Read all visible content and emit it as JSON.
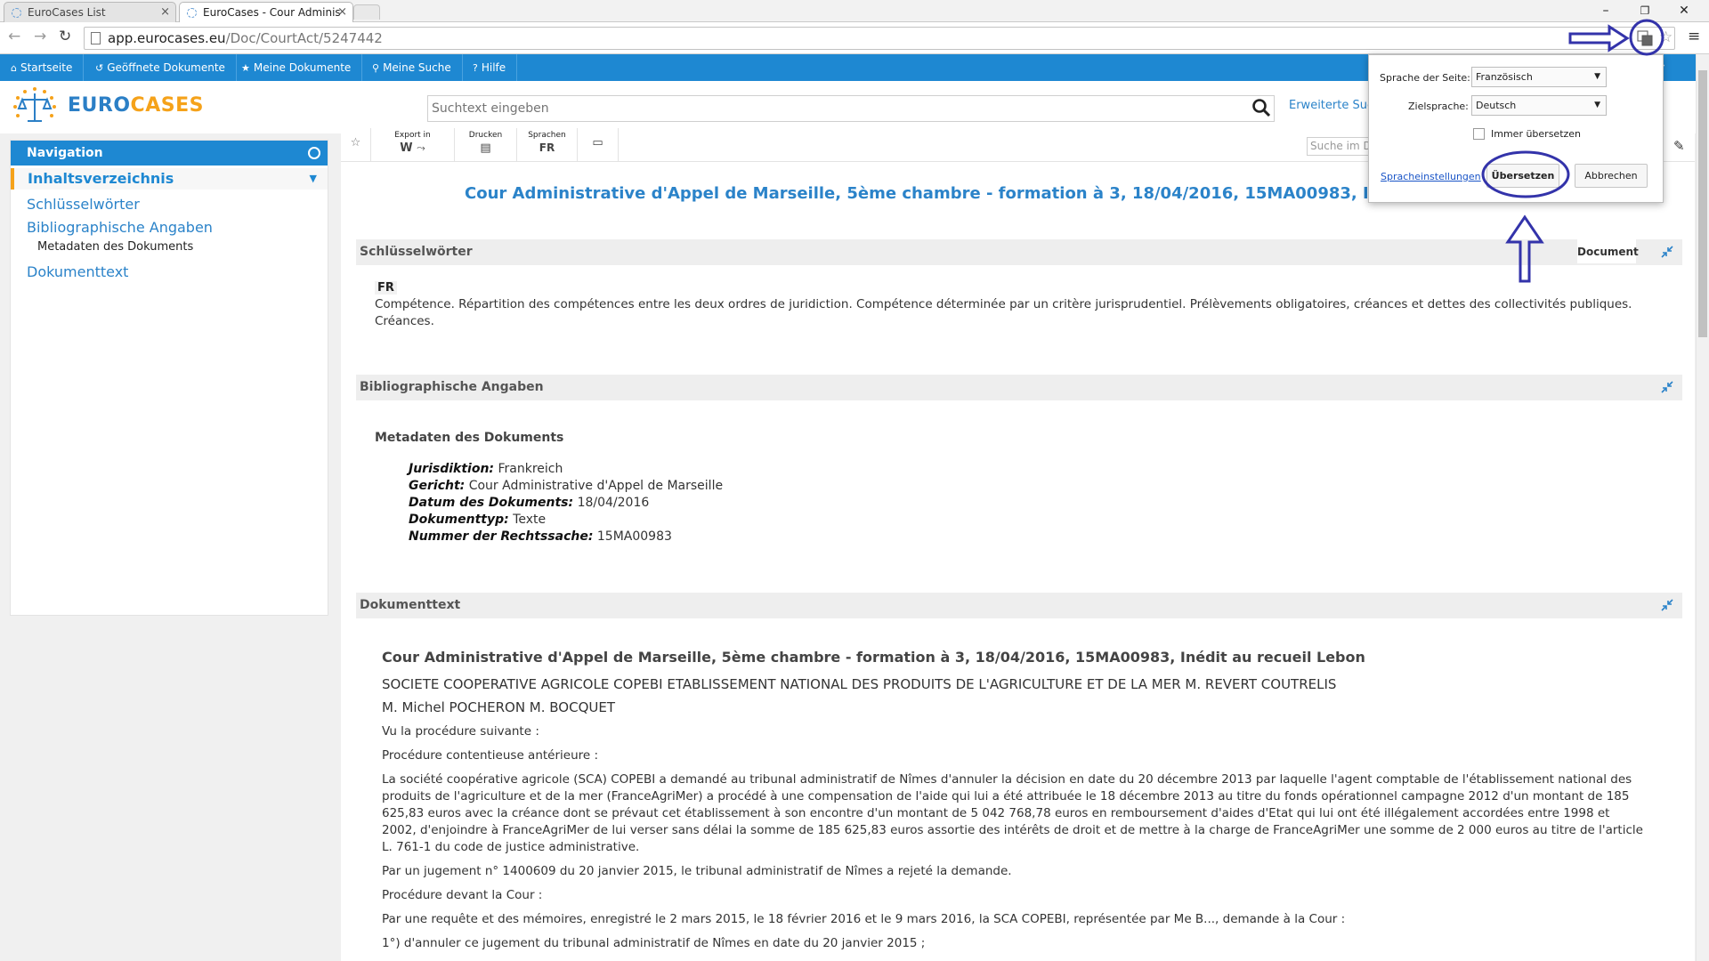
{
  "browser": {
    "tabs": [
      {
        "title": "EuroCases List"
      },
      {
        "title": "EuroCases - Cour Adminis"
      }
    ],
    "url_host": "app.eurocases.eu",
    "url_path": "/Doc/CourtAct/5247442"
  },
  "appnav": {
    "items": [
      {
        "label": "Startseite"
      },
      {
        "label": "Geöffnete Dokumente"
      },
      {
        "label": "Meine Dokumente"
      },
      {
        "label": "Meine Suche"
      },
      {
        "label": "Hilfe"
      }
    ]
  },
  "brand": {
    "part1": "EURO",
    "part2": "CASES"
  },
  "search": {
    "placeholder": "Suchtext eingeben",
    "advanced": "Erweiterte Suche"
  },
  "sidebar": {
    "header": "Navigation",
    "toc": "Inhaltsverzeichnis",
    "items": [
      {
        "label": "Schlüsselwörter"
      },
      {
        "label": "Bibliographische Angaben"
      },
      {
        "label": "Metadaten des Dokuments"
      },
      {
        "label": "Dokumenttext"
      }
    ]
  },
  "toolbar": {
    "export_label": "Export in",
    "print_label": "Drucken",
    "lang_label": "Sprachen",
    "lang_value": "FR",
    "find_placeholder": "Suche im Dokument"
  },
  "document": {
    "title": "Cour Administrative d'Appel de Marseille, 5ème chambre - formation à 3, 18/04/2016, 15MA00983, Inédit au recueil Lebon",
    "keywords_section": "Schlüsselwörter",
    "keywords_tab": "Document",
    "keywords_lang": "FR",
    "keywords_text": "Compétence. Répartition des compétences entre les deux ordres de juridiction. Compétence déterminée par un critère jurisprudentiel. Prélèvements obligatoires, créances et dettes des collectivités publiques. Créances.",
    "biblio_section": "Bibliographische Angaben",
    "meta_heading": "Metadaten des Dokuments",
    "meta": [
      {
        "key": "Jurisdiktion:",
        "value": "Frankreich"
      },
      {
        "key": "Gericht:",
        "value": "Cour Administrative d'Appel de Marseille"
      },
      {
        "key": "Datum des Dokuments:",
        "value": "18/04/2016"
      },
      {
        "key": "Dokumenttyp:",
        "value": "Texte"
      },
      {
        "key": "Nummer der Rechtssache:",
        "value": "15MA00983"
      }
    ],
    "text_section": "Dokumenttext",
    "text_title": "Cour Administrative d'Appel de Marseille, 5ème chambre - formation à 3, 18/04/2016, 15MA00983, Inédit au recueil Lebon",
    "parties": "SOCIETE COOPERATIVE AGRICOLE COPEBI ETABLISSEMENT NATIONAL DES PRODUITS DE L'AGRICULTURE ET DE LA MER M. REVERT COUTRELIS",
    "judges": "M. Michel POCHERON M. BOCQUET",
    "paragraphs": [
      "Vu la procédure suivante :",
      "Procédure contentieuse antérieure :",
      "La société coopérative agricole (SCA) COPEBI a demandé au tribunal administratif de Nîmes d'annuler la décision en date du 20 décembre 2013 par laquelle l'agent comptable de l'établissement national des produits de l'agriculture et de la mer (FranceAgriMer) a procédé à une compensation de l'aide qui lui a été attribuée le 18 décembre 2013 au titre du fonds opérationnel campagne 2012 d'un montant de 185 625,83 euros avec la créance dont se prévaut cet établissement à son encontre d'un montant de 5 042 768,78 euros en remboursement d'aides d'Etat qui lui ont été illégalement accordées entre 1998 et 2002, d'enjoindre à FranceAgriMer de lui verser sans délai la somme de 185 625,83 euros assortie des intérêts de droit et de mettre à la charge de FranceAgriMer une somme de 2 000 euros au titre de l'article L. 761-1 du code de justice administrative.",
      "Par un jugement n° 1400609 du 20 janvier 2015, le tribunal administratif de Nîmes a rejeté la demande.",
      "Procédure devant la Cour :",
      "Par une requête et des mémoires, enregistré le 2 mars 2015, le 18 février 2016 et le 9 mars 2016, la SCA COPEBI, représentée par Me B..., demande à la Cour :",
      "1°) d'annuler ce jugement du tribunal administratif de Nîmes en date du 20 janvier 2015 ;"
    ]
  },
  "translate_popup": {
    "source_label": "Sprache der Seite:",
    "source_value": "Französisch",
    "target_label": "Zielsprache:",
    "target_value": "Deutsch",
    "always_label": "Immer übersetzen",
    "settings_link": "Spracheinstellungen",
    "translate_button": "Übersetzen",
    "cancel_button": "Abbrechen"
  },
  "colors": {
    "brand_blue": "#1e88d2",
    "brand_orange": "#f5a21a",
    "annotation": "#3333aa"
  }
}
